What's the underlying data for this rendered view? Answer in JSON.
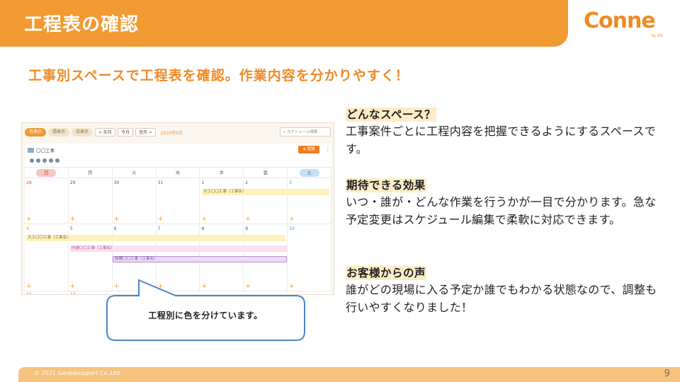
{
  "header": {
    "title": "工程表の確認"
  },
  "logo": {
    "text": "Conne",
    "sub": "by GG"
  },
  "headline": "工事別スペースで工程表を確認。作業内容を分かりやすく！",
  "screenshot": {
    "view_buttons": [
      "月表示",
      "週表示",
      "日表示"
    ],
    "nav_buttons": [
      "< 前月",
      "今月",
      "翌月 >"
    ],
    "month_label": "2024年6月",
    "search_placeholder": "スケジュール検索",
    "project_name": "〇〇工事",
    "register_label": "登録",
    "weekdays": [
      "日",
      "月",
      "火",
      "水",
      "木",
      "金",
      "土"
    ],
    "week1_days": [
      "28",
      "29",
      "30",
      "31",
      "1",
      "2",
      "3"
    ],
    "week2_days": [
      "4",
      "5",
      "6",
      "7",
      "8",
      "9",
      "10"
    ],
    "week3_days": [
      "11",
      "12"
    ],
    "events": [
      "大工〇〇工事（工事名）",
      "大工〇〇工事（工事名）",
      "内装〇〇工事（工事名）",
      "設備〇〇工事（工事名）"
    ]
  },
  "callout": "工程別に色を分けています。",
  "sections": [
    {
      "heading": "どんなスペース？",
      "body": "工事案件ごとに工程内容を把握できるようにするスペースです。"
    },
    {
      "heading": "期待できる効果",
      "body": "いつ・誰が・どんな作業を行うかが一目で分かります。急な予定変更はスケジュール編集で柔軟に対応できます。"
    },
    {
      "heading": "お客様からの声",
      "body": "誰がどの現場に入る予定か誰でもわかる状態なので、調整も行いやすくなりました！"
    }
  ],
  "footer": {
    "copyright": "© 2021 Genbasupport Co.,Ltd.",
    "page": "9"
  },
  "colors": {
    "accent": "#f19a32",
    "heading_bg": "#fdedc6",
    "footer": "#f6c27e"
  }
}
